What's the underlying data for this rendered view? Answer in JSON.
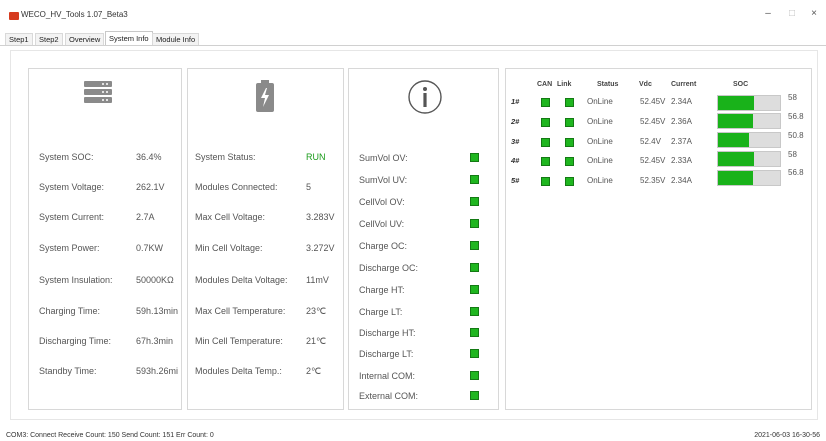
{
  "window": {
    "title": "WECO_HV_Tools 1.07_Beta3",
    "minimize": "–",
    "maximize": "□",
    "close": "×"
  },
  "tabs": [
    {
      "label": "Step1"
    },
    {
      "label": "Step2"
    },
    {
      "label": "Overview"
    },
    {
      "label": "System Info"
    },
    {
      "label": "Module Info"
    }
  ],
  "active_tab": "System Info",
  "colors": {
    "ok_green": "#1fb61f",
    "run_green": "#1a9b1a"
  },
  "system": [
    {
      "label": "System SOC:",
      "value": "36.4%"
    },
    {
      "label": "System Voltage:",
      "value": "262.1V"
    },
    {
      "label": "System Current:",
      "value": "2.7A"
    },
    {
      "label": "System Power:",
      "value": "0.7KW"
    },
    {
      "label": "System Insulation:",
      "value": "50000KΩ"
    },
    {
      "label": "Charging Time:",
      "value": "59h.13min"
    },
    {
      "label": "Discharging Time:",
      "value": "67h.3min"
    },
    {
      "label": "Standby Time:",
      "value": "593h.26mi"
    }
  ],
  "status": [
    {
      "label": "System Status:",
      "value": "RUN"
    },
    {
      "label": "Modules Connected:",
      "value": "5"
    },
    {
      "label": "Max Cell Voltage:",
      "value": "3.283V"
    },
    {
      "label": "Min Cell Voltage:",
      "value": "3.272V"
    },
    {
      "label": "Modules Delta Voltage:",
      "value": "11mV"
    },
    {
      "label": "Max Cell Temperature:",
      "value": "23℃"
    },
    {
      "label": "Min Cell Temperature:",
      "value": "21℃"
    },
    {
      "label": "Modules Delta Temp.:",
      "value": "2℃"
    }
  ],
  "protections": [
    {
      "label": "SumVol OV:",
      "ok": true
    },
    {
      "label": "SumVol UV:",
      "ok": true
    },
    {
      "label": "CellVol OV:",
      "ok": true
    },
    {
      "label": "CellVol UV:",
      "ok": true
    },
    {
      "label": "Charge OC:",
      "ok": true
    },
    {
      "label": "Discharge OC:",
      "ok": true
    },
    {
      "label": "Charge HT:",
      "ok": true
    },
    {
      "label": "Charge LT:",
      "ok": true
    },
    {
      "label": "Discharge HT:",
      "ok": true
    },
    {
      "label": "Discharge LT:",
      "ok": true
    },
    {
      "label": "Internal COM:",
      "ok": true
    },
    {
      "label": "External COM:",
      "ok": true
    }
  ],
  "modules_header": {
    "can": "CAN",
    "link": "Link",
    "status": "Status",
    "vdc": "Vdc",
    "current": "Current",
    "soc": "SOC"
  },
  "modules": [
    {
      "id": "1#",
      "status": "OnLine",
      "vdc": "52.45V",
      "current": "2.34A",
      "soc": "58",
      "soc_pct": 58
    },
    {
      "id": "2#",
      "status": "OnLine",
      "vdc": "52.45V",
      "current": "2.36A",
      "soc": "56.8",
      "soc_pct": 56.8
    },
    {
      "id": "3#",
      "status": "OnLine",
      "vdc": "52.4V",
      "current": "2.37A",
      "soc": "50.8",
      "soc_pct": 50.8
    },
    {
      "id": "4#",
      "status": "OnLine",
      "vdc": "52.45V",
      "current": "2.33A",
      "soc": "58",
      "soc_pct": 58
    },
    {
      "id": "5#",
      "status": "OnLine",
      "vdc": "52.35V",
      "current": "2.34A",
      "soc": "56.8",
      "soc_pct": 56.8
    }
  ],
  "statusbar": {
    "left": "COM3: Connect  Receive Count: 150  Send Count: 151  Err Count: 0",
    "right": "2021-06-03 16-30-56"
  },
  "icons": {
    "app": "app-logo-icon",
    "server": "server-icon",
    "battery": "battery-icon",
    "info": "info-icon"
  }
}
